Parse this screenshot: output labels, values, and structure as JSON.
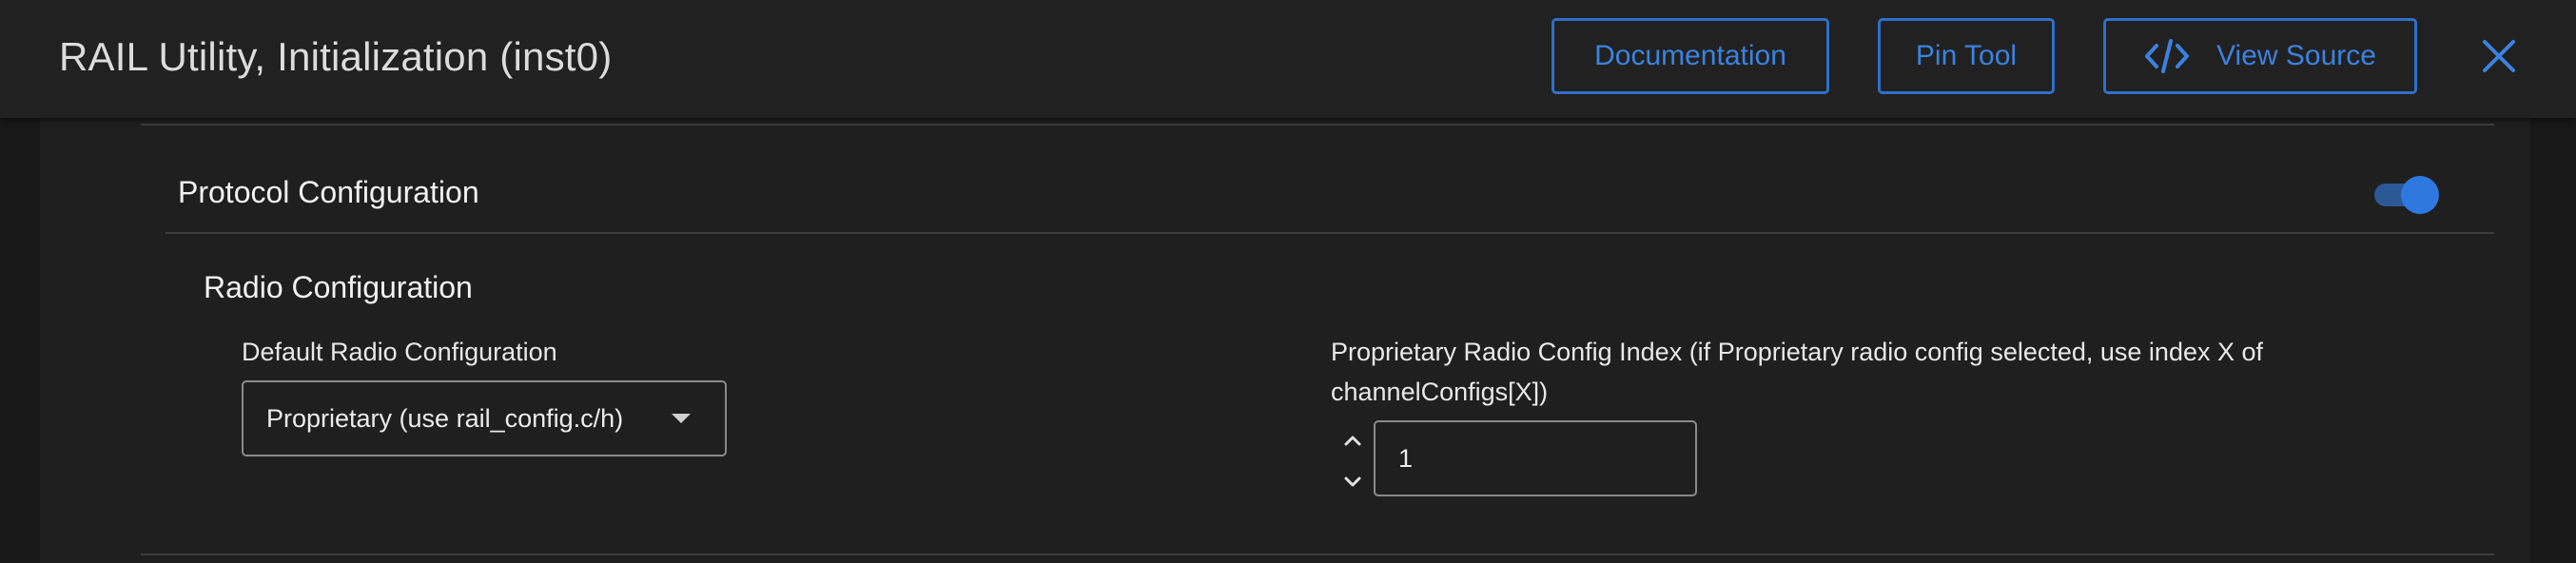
{
  "header": {
    "title": "RAIL Utility, Initialization (inst0)",
    "buttons": {
      "documentation": "Documentation",
      "pin_tool": "Pin Tool",
      "view_source": "View Source"
    },
    "icons": {
      "view_source": "code-icon",
      "close": "close-icon"
    }
  },
  "section": {
    "title": "Protocol Configuration",
    "toggle_on": true
  },
  "subsection": {
    "title": "Radio Configuration",
    "default_radio_config": {
      "label": "Default Radio Configuration",
      "value": "Proprietary (use rail_config.c/h)"
    },
    "config_index": {
      "label_line1": "Proprietary Radio Config Index (if Proprietary radio config selected, use index X of",
      "label_line2": "channelConfigs[X])",
      "value": "1"
    }
  },
  "colors": {
    "accent": "#3b82e0",
    "header_bg": "#212121",
    "panel_bg": "#1f1f1f",
    "page_bg": "#181818"
  }
}
